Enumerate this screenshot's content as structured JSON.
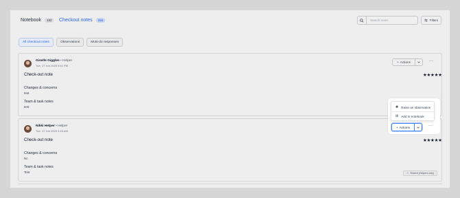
{
  "header": {
    "notebook": {
      "label": "Notebook",
      "count": "182"
    },
    "checkout_notes": {
      "label": "Checkout notes",
      "count": "256"
    },
    "search_placeholder": "Search notes",
    "filters_label": "Filters"
  },
  "subtabs": [
    "All checkout notes",
    "Observations",
    "Must-do responses"
  ],
  "notes": [
    {
      "name": "Giselle Giggles",
      "role": "• Helper",
      "date": "Tue, 17 Jun 2025 5:41 PM",
      "title": "Check-out note",
      "stars": "★★★★★",
      "changes_label": "Changes & concerns",
      "changes_value": "test",
      "team_label": "Team & task notes",
      "team_value": "test"
    },
    {
      "name": "Nikki Helper",
      "role": "• Helper",
      "date": "Tue, 17 Jun 2025 9:15 AM",
      "title": "Check-out note",
      "stars": "★★★★★",
      "changes_label": "Changes & concerns",
      "changes_value": "Nc",
      "team_label": "Team & task notes",
      "team_value": "Test",
      "shared": "Shared (Helpers only)"
    }
  ],
  "actions_label": "Actions",
  "menu": {
    "raise": "Raise an observation",
    "add": "Add to notebook"
  },
  "icons": {
    "search": "search-icon",
    "filters": "filters-icon",
    "plus": "plus-icon",
    "chevron": "chevron-down-icon",
    "more": "more-icon"
  },
  "colors": {
    "accent": "#2563eb"
  }
}
